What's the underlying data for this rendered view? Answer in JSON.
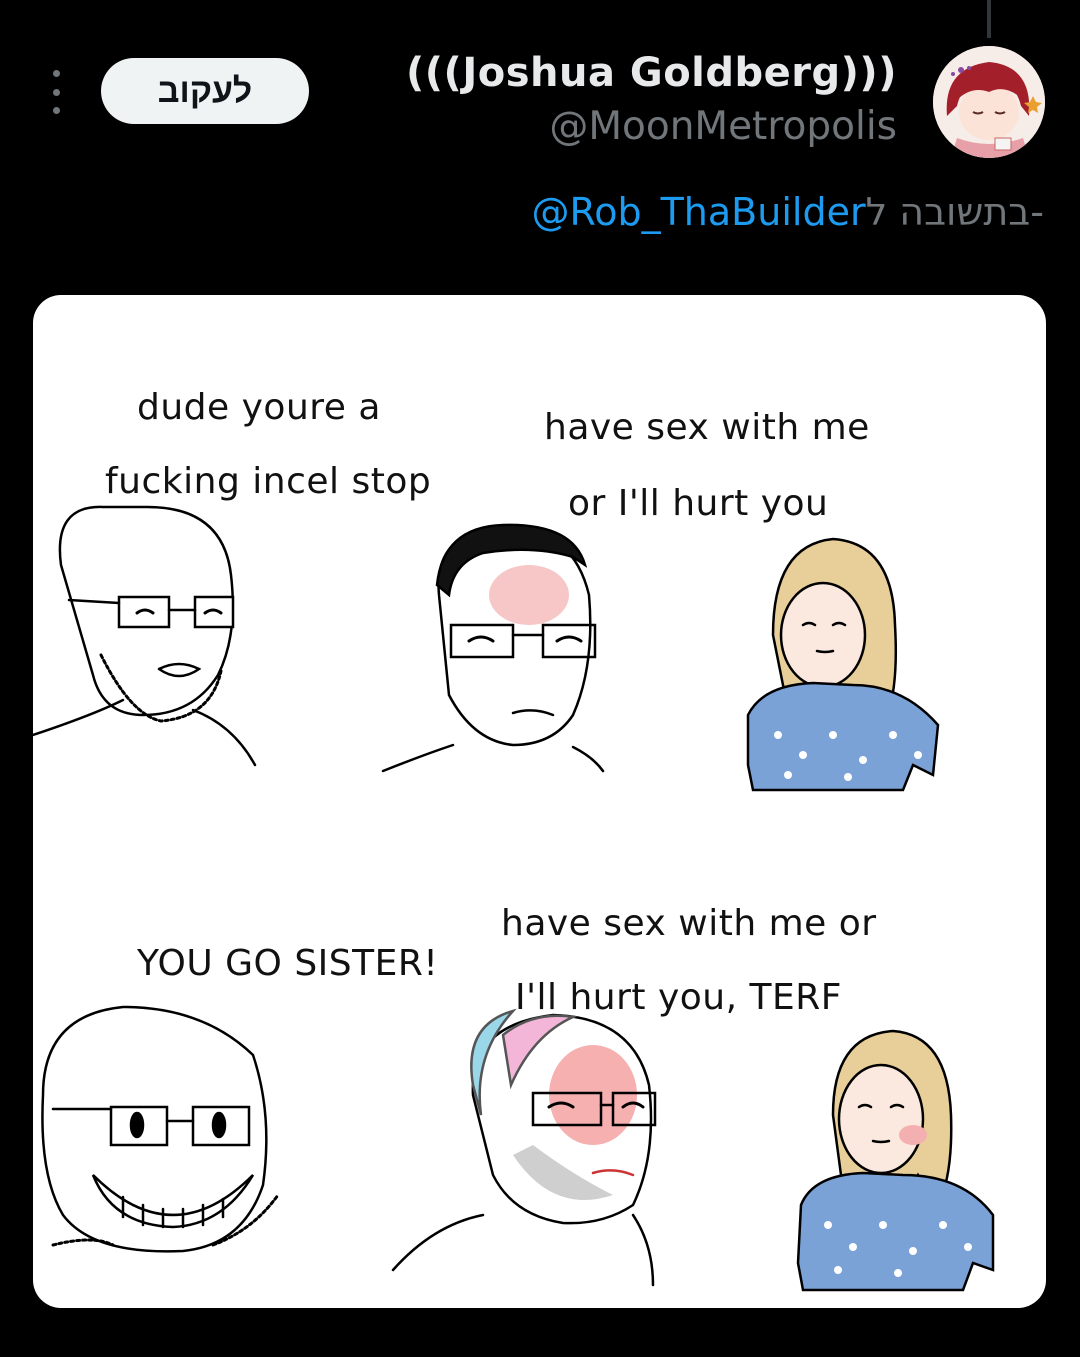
{
  "tweet": {
    "display_name": "(((Joshua Goldberg)))",
    "handle": "@MoonMetropolis",
    "follow_label": "לעקוב",
    "reply_prefix": "בתשובה ל-",
    "reply_mention": "@Rob_ThaBuilder",
    "more_icon": "more-vertical-icon"
  },
  "meme": {
    "panel1": {
      "wojak_line1": "dude youre a",
      "wojak_line2": "fucking incel stop",
      "chud_line1": "have sex with me",
      "chud_line2": "or I'll hurt you"
    },
    "panel2": {
      "wojak_line": "YOU GO SISTER!",
      "chud_line1": "have sex with me or",
      "chud_line2": "I'll hurt you, TERF"
    }
  }
}
